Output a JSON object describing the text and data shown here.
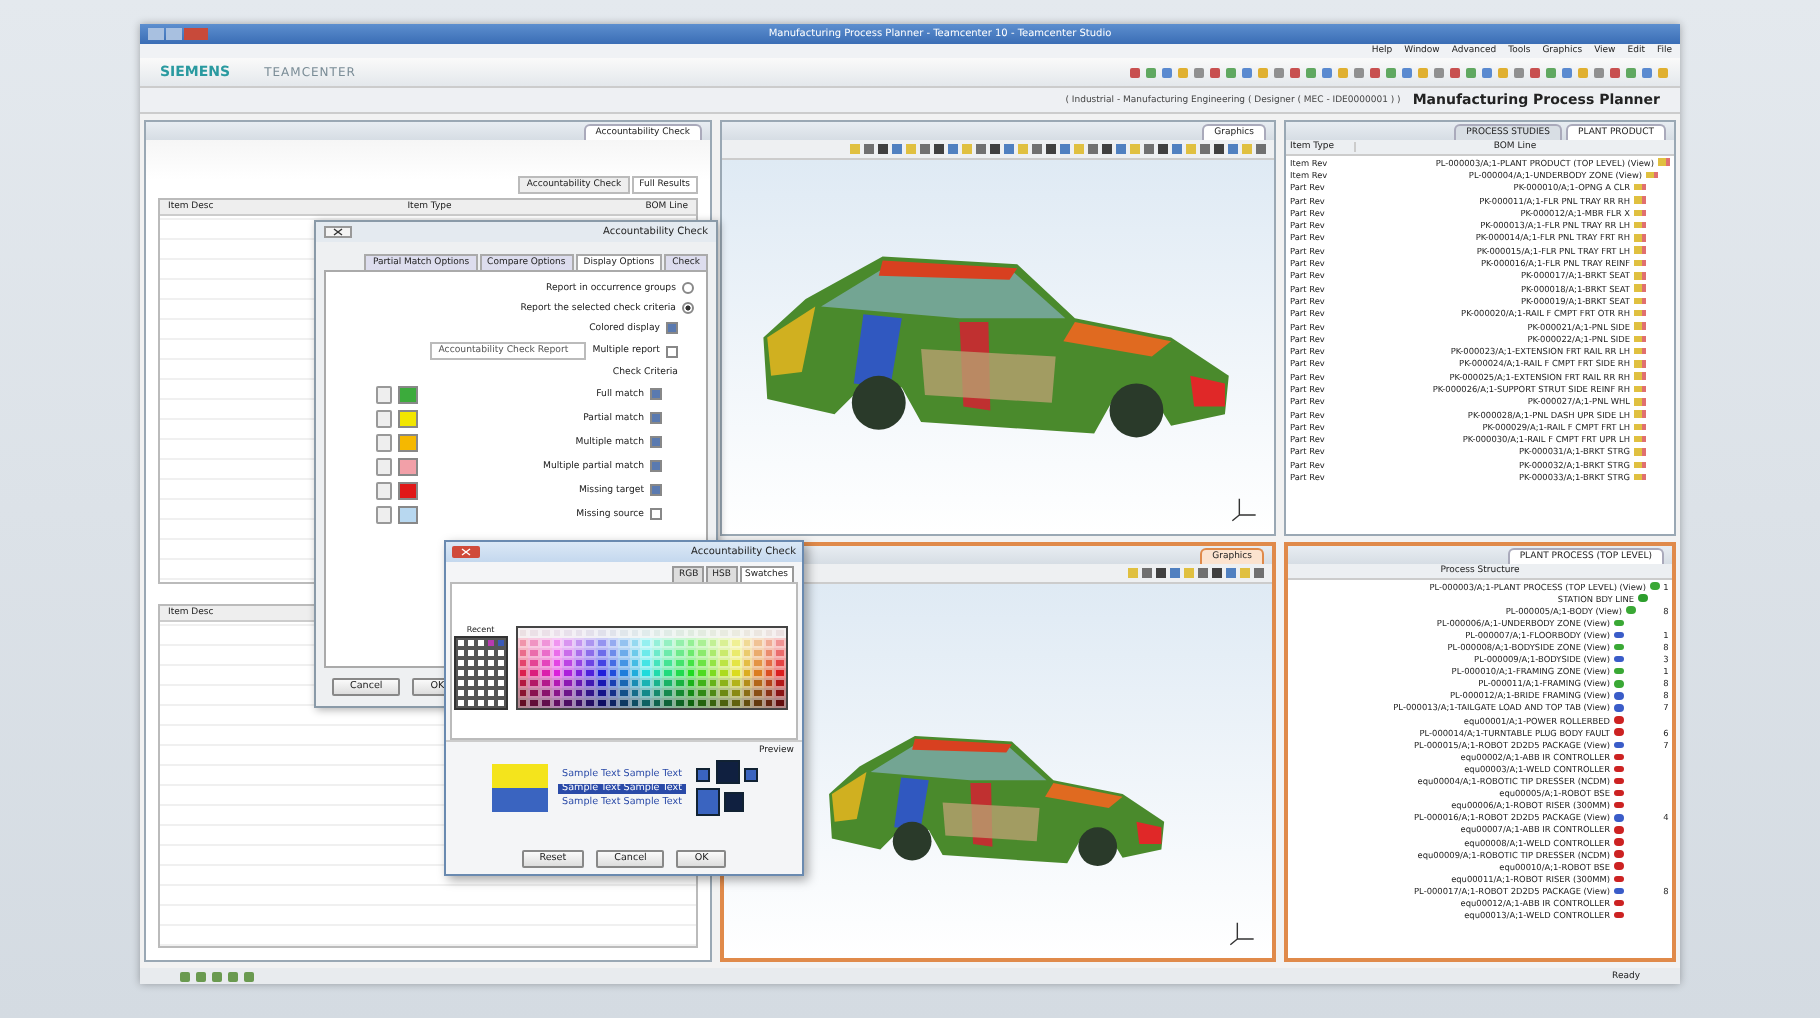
{
  "window": {
    "title": "Manufacturing Process Planner - Teamcenter 10 - Teamcenter Studio"
  },
  "menu": [
    "Help",
    "Window",
    "Advanced",
    "Tools",
    "Graphics",
    "View",
    "Edit",
    "File"
  ],
  "brand": {
    "product": "TEAMCENTER",
    "company": "SIEMENS"
  },
  "perspective": {
    "title": "Manufacturing Process Planner",
    "path": "( Industrial - Manufacturing Engineering ( Designer ( MEC - IDE0000001 ) )"
  },
  "bom_panel": {
    "tabs": [
      {
        "label": "PROCESS STUDIES",
        "selected": false
      },
      {
        "label": "PLANT PRODUCT",
        "selected": true
      }
    ],
    "columns": [
      "Item Type",
      "BOM Line"
    ],
    "rows": [
      {
        "label": "PL-000003/A;1-PLANT PRODUCT (TOP LEVEL) (View)",
        "type": "Item Rev"
      },
      {
        "label": "PL-000004/A;1-UNDERBODY ZONE (View)",
        "type": "Item Rev"
      },
      {
        "label": "PK-000010/A;1-OPNG A CLR",
        "type": "Part Rev"
      },
      {
        "label": "PK-000011/A;1-FLR PNL TRAY RR RH",
        "type": "Part Rev"
      },
      {
        "label": "PK-000012/A;1-MBR FLR X",
        "type": "Part Rev"
      },
      {
        "label": "PK-000013/A;1-FLR PNL TRAY RR LH",
        "type": "Part Rev"
      },
      {
        "label": "PK-000014/A;1-FLR PNL TRAY FRT RH",
        "type": "Part Rev"
      },
      {
        "label": "PK-000015/A;1-FLR PNL TRAY FRT LH",
        "type": "Part Rev"
      },
      {
        "label": "PK-000016/A;1-FLR PNL TRAY REINF",
        "type": "Part Rev"
      },
      {
        "label": "PK-000017/A;1-BRKT SEAT",
        "type": "Part Rev"
      },
      {
        "label": "PK-000018/A;1-BRKT SEAT",
        "type": "Part Rev"
      },
      {
        "label": "PK-000019/A;1-BRKT SEAT",
        "type": "Part Rev"
      },
      {
        "label": "PK-000020/A;1-RAIL F CMPT FRT OTR RH",
        "type": "Part Rev"
      },
      {
        "label": "PK-000021/A;1-PNL SIDE",
        "type": "Part Rev"
      },
      {
        "label": "PK-000022/A;1-PNL SIDE",
        "type": "Part Rev"
      },
      {
        "label": "PK-000023/A;1-EXTENSION FRT RAIL RR LH",
        "type": "Part Rev"
      },
      {
        "label": "PK-000024/A;1-RAIL F CMPT FRT SIDE RH",
        "type": "Part Rev"
      },
      {
        "label": "PK-000025/A;1-EXTENSION FRT RAIL RR RH",
        "type": "Part Rev"
      },
      {
        "label": "PK-000026/A;1-SUPPORT STRUT SIDE REINF RH",
        "type": "Part Rev"
      },
      {
        "label": "PK-000027/A;1-PNL WHL",
        "type": "Part Rev"
      },
      {
        "label": "PK-000028/A;1-PNL DASH UPR SIDE LH",
        "type": "Part Rev"
      },
      {
        "label": "PK-000029/A;1-RAIL F CMPT FRT LH",
        "type": "Part Rev"
      },
      {
        "label": "PK-000030/A;1-RAIL F CMPT FRT UPR LH",
        "type": "Part Rev"
      },
      {
        "label": "PK-000031/A;1-BRKT STRG",
        "type": "Part Rev"
      },
      {
        "label": "PK-000032/A;1-BRKT STRG",
        "type": "Part Rev"
      },
      {
        "label": "PK-000033/A;1-BRKT STRG",
        "type": "Part Rev"
      }
    ]
  },
  "process_panel": {
    "tab": "PLANT PROCESS (TOP LEVEL)",
    "column": "Process Structure",
    "rows": [
      {
        "label": "PL-000003/A;1-PLANT PROCESS (TOP LEVEL) (View)",
        "seq": "1",
        "kind": "process",
        "children": [
          {
            "label": "STATION BDY LINE",
            "kind": "line",
            "children": [
              {
                "label": "PL-000005/A;1-BODY (View)",
                "seq": "8",
                "kind": "process",
                "children": [
                  {
                    "label": "PL-000006/A;1-UNDERBODY ZONE (View)",
                    "kind": "process"
                  },
                  {
                    "label": "PL-000007/A;1-FLOORBODY (View)",
                    "seq": "1",
                    "kind": "operation"
                  },
                  {
                    "label": "PL-000008/A;1-BODYSIDE ZONE (View)",
                    "seq": "8",
                    "kind": "process"
                  },
                  {
                    "label": "PL-000009/A;1-BODYSIDE (View)",
                    "seq": "3",
                    "kind": "operation"
                  },
                  {
                    "label": "PL-000010/A;1-FRAMING ZONE (View)",
                    "seq": "1",
                    "kind": "process"
                  },
                  {
                    "label": "PL-000011/A;1-FRAMING (View)",
                    "seq": "8",
                    "kind": "process"
                  },
                  {
                    "label": "PL-000012/A;1-BRIDE FRAMING (View)",
                    "seq": "8",
                    "kind": "operation"
                  },
                  {
                    "label": "PL-000013/A;1-TAILGATE LOAD AND TOP TAB (View)",
                    "seq": "7",
                    "kind": "operation"
                  },
                  {
                    "label": "equ00001/A;1-POWER ROLLERBED",
                    "kind": "resource"
                  },
                  {
                    "label": "PL-000014/A;1-TURNTABLE PLUG BODY FAULT",
                    "seq": "6",
                    "kind": "resource"
                  },
                  {
                    "label": "PL-000015/A;1-ROBOT 2D2D5 PACKAGE (View)",
                    "seq": "7",
                    "kind": "operation"
                  },
                  {
                    "label": "equ00002/A;1-ABB IR CONTROLLER",
                    "kind": "resource"
                  },
                  {
                    "label": "equ00003/A;1-WELD CONTROLLER",
                    "kind": "resource"
                  },
                  {
                    "label": "equ00004/A;1-ROBOTIC TIP DRESSER (NCDM)",
                    "kind": "resource"
                  },
                  {
                    "label": "equ00005/A;1-ROBOT BSE",
                    "kind": "resource"
                  },
                  {
                    "label": "equ00006/A;1-ROBOT RISER (300MM)",
                    "kind": "resource"
                  },
                  {
                    "label": "PL-000016/A;1-ROBOT 2D2D5 PACKAGE (View)",
                    "seq": "4",
                    "kind": "operation"
                  },
                  {
                    "label": "equ00007/A;1-ABB IR CONTROLLER",
                    "kind": "resource"
                  },
                  {
                    "label": "equ00008/A;1-WELD CONTROLLER",
                    "kind": "resource"
                  },
                  {
                    "label": "equ00009/A;1-ROBOTIC TIP DRESSER (NCDM)",
                    "kind": "resource"
                  },
                  {
                    "label": "equ00010/A;1-ROBOT BSE",
                    "kind": "resource"
                  },
                  {
                    "label": "equ00011/A;1-ROBOT RISER (300MM)",
                    "kind": "resource"
                  },
                  {
                    "label": "PL-000017/A;1-ROBOT 2D2D5 PACKAGE (View)",
                    "seq": "8",
                    "kind": "operation"
                  },
                  {
                    "label": "equ00012/A;1-ABB IR CONTROLLER",
                    "kind": "resource"
                  },
                  {
                    "label": "equ00013/A;1-WELD CONTROLLER",
                    "kind": "resource"
                  }
                ]
              }
            ]
          }
        ]
      }
    ]
  },
  "graphics": [
    {
      "tab": "Graphics",
      "active": false
    },
    {
      "tab": "Graphics",
      "active": true
    }
  ],
  "check_panel": {
    "tab": "Accountability Check",
    "result_tabs": [
      {
        "label": "Accountability Check",
        "selected": false
      },
      {
        "label": "Full Results",
        "selected": true
      }
    ],
    "columns": [
      "Item Desc",
      "Item Type",
      "BOM Line"
    ],
    "lower_column": "Item Desc"
  },
  "check_dialog": {
    "title": "Accountability Check",
    "tabs": [
      {
        "label": "Partial Match Options",
        "selected": false
      },
      {
        "label": "Compare Options",
        "selected": false
      },
      {
        "label": "Display Options",
        "selected": true
      },
      {
        "label": "Check",
        "selected": false
      }
    ],
    "report_options": [
      {
        "label": "Report in occurrence groups",
        "selected": false
      },
      {
        "label": "Report the selected check criteria",
        "selected": true
      }
    ],
    "colored_display": {
      "label": "Colored display",
      "checked": true
    },
    "multiple_report": {
      "label": "Multiple report",
      "checked": false,
      "value": "Accountability Check Report"
    },
    "criteria_title": "Check Criteria",
    "criteria": [
      {
        "label": "Full match",
        "checked": true,
        "color": "#3cab3c"
      },
      {
        "label": "Partial match",
        "checked": true,
        "color": "#f2e600"
      },
      {
        "label": "Multiple match",
        "checked": true,
        "color": "#f5b800"
      },
      {
        "label": "Multiple partial match",
        "checked": true,
        "color": "#f2a0a8"
      },
      {
        "label": "Missing target",
        "checked": true,
        "color": "#e01818"
      },
      {
        "label": "Missing source",
        "checked": false,
        "color": "#b8d8f0"
      }
    ],
    "buttons": [
      "Cancel",
      "OK"
    ]
  },
  "color_dialog": {
    "title": "Accountability Check",
    "tabs": [
      {
        "label": "RGB",
        "selected": false
      },
      {
        "label": "HSB",
        "selected": false
      },
      {
        "label": "Swatches",
        "selected": true
      }
    ],
    "recent_label": "Recent",
    "preview_label": "Preview",
    "samples": [
      {
        "text": "Sample Text  Sample Text",
        "selected": false
      },
      {
        "text": "Sample Text  Sample Text",
        "selected": true
      },
      {
        "text": "Sample Text  Sample Text",
        "selected": false
      }
    ],
    "buttons": [
      "Reset",
      "Cancel",
      "OK"
    ]
  },
  "status": "Ready"
}
